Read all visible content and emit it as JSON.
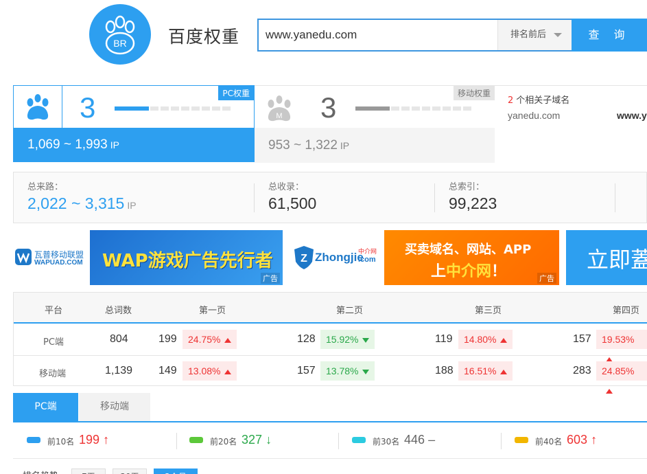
{
  "header": {
    "logo_text": "BR",
    "title": "百度权重",
    "search_value": "www.yanedu.com",
    "sort_select": "排名前后",
    "search_button": "查 询"
  },
  "pc_weight": {
    "rank": "3",
    "badge": "PC权重",
    "ip_range": "1,069 ~ 1,993",
    "ip_unit": "IP",
    "level_fraction": 0.3
  },
  "mobile_weight": {
    "rank": "3",
    "badge": "移动权重",
    "ip_range": "953 ~ 1,322",
    "ip_unit": "IP",
    "level_fraction": 0.3
  },
  "subdomains": {
    "count": "2",
    "label": "个相关子域名",
    "items": [
      "yanedu.com",
      "www.y"
    ]
  },
  "stats": {
    "total_flow_label": "总来路：",
    "total_flow_value": "2,022 ~ 3,315",
    "total_flow_unit": "IP",
    "indexed_label": "总收录：",
    "indexed_value": "61,500",
    "index_label": "总索引：",
    "index_value": "99,223"
  },
  "ads": {
    "ad1_brand_top": "瓦普移动联盟",
    "ad1_brand_bottom": "WAPUAD.COM",
    "ad1_text": "WAP游戏广告先行者",
    "ad2_brand": "Zhongjie",
    "ad2_brand_sub": "中介网",
    "ad2_brand_dot": ".com",
    "ad2_text_line1": "买卖域名、网站、APP",
    "ad2_text_line2a": "上",
    "ad2_text_line2b": "中介网",
    "ad2_text_line2c": "！",
    "ad3_text": "立即蓋",
    "ad_tag": "广告"
  },
  "rank_table": {
    "headers": [
      "平台",
      "总词数",
      "第一页",
      "第二页",
      "第三页",
      "第四页"
    ],
    "rows": [
      {
        "platform": "PC端",
        "total": "804",
        "pages": [
          {
            "count": "199",
            "pct": "24.75%",
            "dir": "up"
          },
          {
            "count": "128",
            "pct": "15.92%",
            "dir": "down"
          },
          {
            "count": "119",
            "pct": "14.80%",
            "dir": "up"
          },
          {
            "count": "157",
            "pct": "19.53%",
            "dir": "up"
          }
        ]
      },
      {
        "platform": "移动端",
        "total": "1,139",
        "pages": [
          {
            "count": "149",
            "pct": "13.08%",
            "dir": "up"
          },
          {
            "count": "157",
            "pct": "13.78%",
            "dir": "down"
          },
          {
            "count": "188",
            "pct": "16.51%",
            "dir": "up"
          },
          {
            "count": "283",
            "pct": "24.85%",
            "dir": "up"
          }
        ]
      }
    ]
  },
  "tabs": [
    "PC端",
    "移动端"
  ],
  "legend": [
    {
      "label": "前10名",
      "value": "199",
      "trend": "up",
      "color": "#2d9ff0",
      "value_color": "#e33"
    },
    {
      "label": "前20名",
      "value": "327",
      "trend": "down",
      "color": "#5cc83a",
      "value_color": "#2aa84a"
    },
    {
      "label": "前30名",
      "value": "446",
      "trend": "flat",
      "color": "#2ccbe0",
      "value_color": "#666"
    },
    {
      "label": "前40名",
      "value": "603",
      "trend": "up",
      "color": "#f2b600",
      "value_color": "#e33"
    }
  ],
  "trend": {
    "label": "排名趋势",
    "buttons": [
      "7天",
      "30天",
      "3个月"
    ]
  },
  "colors": {
    "accent": "#2d9ff0",
    "up": "#e33",
    "down": "#2aa84a"
  }
}
